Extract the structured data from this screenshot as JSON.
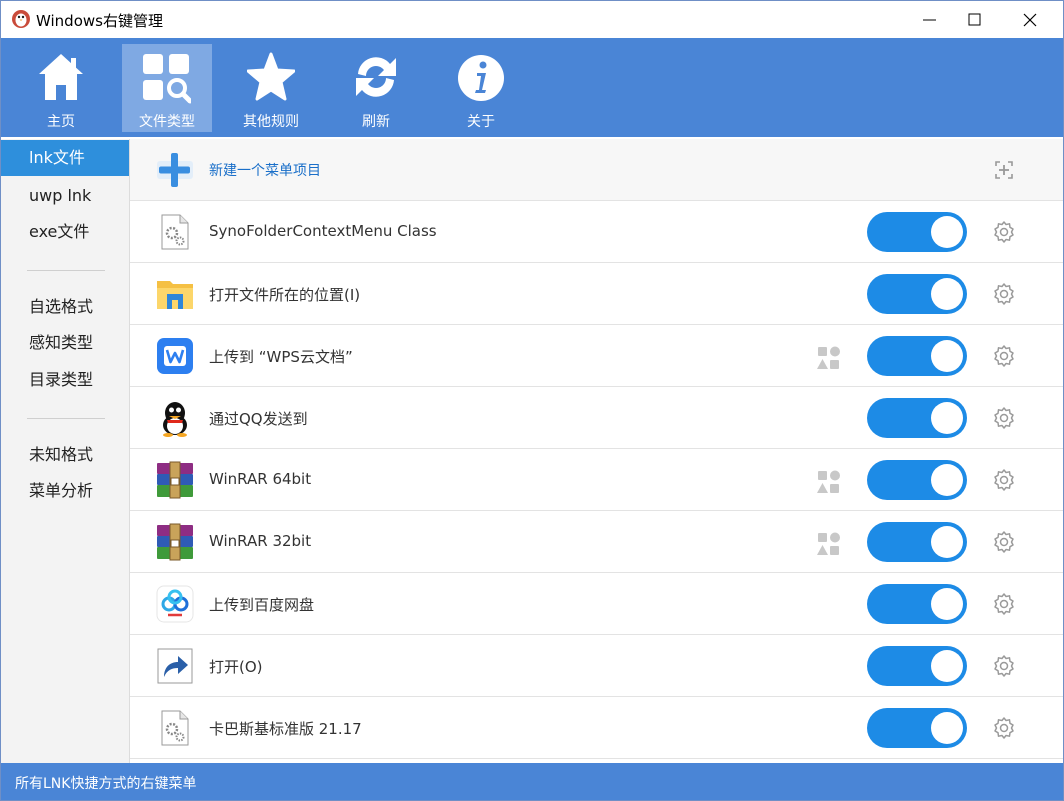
{
  "window": {
    "title": "Windows右键管理"
  },
  "toolbar": {
    "buttons": [
      {
        "label": "主页",
        "icon": "home-icon"
      },
      {
        "label": "文件类型",
        "icon": "file-type-icon",
        "active": true
      },
      {
        "label": "其他规则",
        "icon": "star-icon"
      },
      {
        "label": "刷新",
        "icon": "refresh-icon"
      },
      {
        "label": "关于",
        "icon": "info-icon"
      }
    ]
  },
  "sidebar": {
    "items": [
      {
        "label": "lnk文件",
        "active": true
      },
      {
        "label": "uwp lnk"
      },
      {
        "label": "exe文件"
      },
      {
        "label": "自选格式"
      },
      {
        "label": "感知类型"
      },
      {
        "label": "目录类型"
      },
      {
        "label": "未知格式"
      },
      {
        "label": "菜单分析"
      }
    ]
  },
  "list": {
    "new_item": {
      "label": "新建一个菜单项目",
      "icon": "add-menu-item-icon"
    },
    "items": [
      {
        "label": "SynoFolderContextMenu Class",
        "icon": "gear-file-icon",
        "enabled": true,
        "has_shape_icon": false
      },
      {
        "label": "打开文件所在的位置(I)",
        "icon": "folder-icon",
        "enabled": true,
        "has_shape_icon": false
      },
      {
        "label": "上传到 “WPS云文档”",
        "icon": "wps-icon",
        "enabled": true,
        "has_shape_icon": true
      },
      {
        "label": "通过QQ发送到",
        "icon": "qq-penguin-icon",
        "enabled": true,
        "has_shape_icon": false
      },
      {
        "label": "WinRAR 64bit",
        "icon": "winrar-icon",
        "enabled": true,
        "has_shape_icon": true
      },
      {
        "label": "WinRAR 32bit",
        "icon": "winrar-icon",
        "enabled": true,
        "has_shape_icon": true
      },
      {
        "label": "上传到百度网盘",
        "icon": "baidu-netdisk-icon",
        "enabled": true,
        "has_shape_icon": false
      },
      {
        "label": "打开(O)",
        "icon": "shortcut-arrow-icon",
        "enabled": true,
        "has_shape_icon": false
      },
      {
        "label": "卡巴斯基标准版 21.17",
        "icon": "gear-file-icon",
        "enabled": true,
        "has_shape_icon": false
      }
    ]
  },
  "status": {
    "text": "所有LNK快捷方式的右键菜单"
  },
  "colors": {
    "accent_blue": "#4a85d6",
    "toggle_on": "#1d8be6",
    "sidebar_active": "#2e8fdc"
  }
}
